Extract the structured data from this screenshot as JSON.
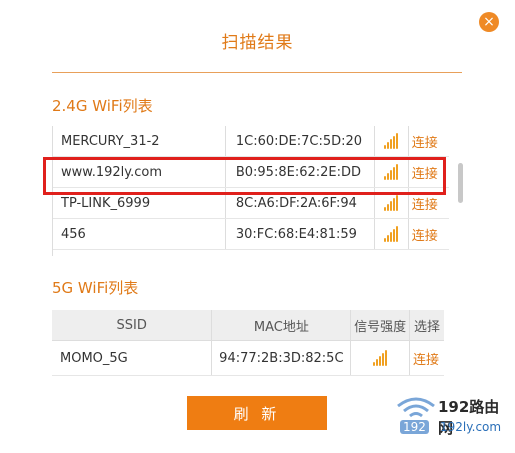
{
  "dialog": {
    "title": "扫描结果",
    "close_glyph": "×",
    "accent": "#e07a18",
    "highlight_color": "#e0201c"
  },
  "wifi24": {
    "section_title": "2.4G WiFi列表",
    "networks": [
      {
        "ssid": "MERCURY_31-2",
        "mac": "1C:60:DE:7C:5D:20",
        "action": "连接"
      },
      {
        "ssid": "www.192ly.com",
        "mac": "B0:95:8E:62:2E:DD",
        "action": "连接"
      },
      {
        "ssid": "TP-LINK_6999",
        "mac": "8C:A6:DF:2A:6F:94",
        "action": "连接"
      },
      {
        "ssid": "456",
        "mac": "30:FC:68:E4:81:59",
        "action": "连接"
      }
    ]
  },
  "wifi5": {
    "section_title": "5G WiFi列表",
    "headers": {
      "ssid": "SSID",
      "mac": "MAC地址",
      "signal": "信号强度",
      "action": "选择"
    },
    "networks": [
      {
        "ssid": "MOMO_5G",
        "mac": "94:77:2B:3D:82:5C",
        "action": "连接"
      }
    ]
  },
  "footer": {
    "refresh_label": "刷 新"
  },
  "watermark": {
    "main": "192路由网",
    "sub_left": "192",
    "sub_right": "192ly.com"
  }
}
